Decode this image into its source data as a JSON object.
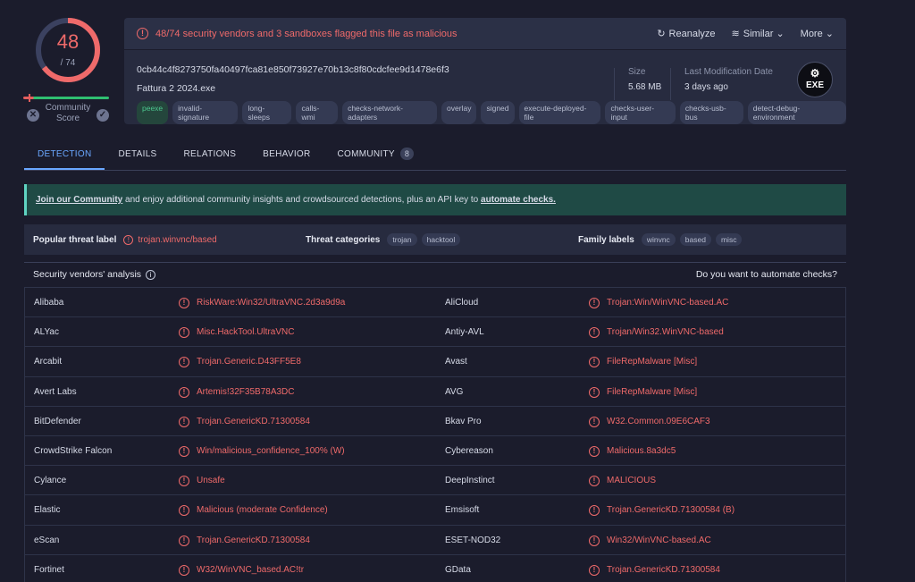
{
  "score": {
    "detected": "48",
    "total": "/ 74",
    "community_label": "Community Score"
  },
  "header": {
    "alert": "48/74 security vendors and 3 sandboxes flagged this file as malicious",
    "actions": {
      "reanalyze": "Reanalyze",
      "similar": "Similar",
      "more": "More"
    },
    "hash": "0cb44c4f8273750fa40497fca81e850f73927e70b13c8f80cdcfee9d1478e6f3",
    "filename": "Fattura 2 2024.exe",
    "tags": [
      "peexe",
      "invalid-signature",
      "long-sleeps",
      "calls-wmi",
      "checks-network-adapters",
      "overlay",
      "signed",
      "execute-deployed-file",
      "checks-user-input",
      "checks-usb-bus",
      "detect-debug-environment"
    ],
    "size_label": "Size",
    "size_value": "5.68 MB",
    "lastmod_label": "Last Modification Date",
    "lastmod_value": "3 days ago",
    "file_type": "EXE"
  },
  "tabs": [
    {
      "label": "DETECTION"
    },
    {
      "label": "DETAILS"
    },
    {
      "label": "RELATIONS"
    },
    {
      "label": "BEHAVIOR"
    },
    {
      "label": "COMMUNITY",
      "count": "8"
    }
  ],
  "banner": {
    "join": "Join our Community",
    "middle": " and enjoy additional community insights and crowdsourced detections, plus an API key to ",
    "automate": "automate checks."
  },
  "threat": {
    "popular_label": "Popular threat label",
    "popular_value": "trojan.winvnc/based",
    "categories_label": "Threat categories",
    "categories": [
      "trojan",
      "hacktool"
    ],
    "family_label": "Family labels",
    "families": [
      "winvnc",
      "based",
      "misc"
    ]
  },
  "vendors_header": {
    "title": "Security vendors' analysis",
    "automate": "Do you want to automate checks?"
  },
  "vendors": [
    [
      {
        "name": "Alibaba",
        "result": "RiskWare:Win32/UltraVNC.2d3a9d9a"
      },
      {
        "name": "AliCloud",
        "result": "Trojan:Win/WinVNC-based.AC"
      }
    ],
    [
      {
        "name": "ALYac",
        "result": "Misc.HackTool.UltraVNC"
      },
      {
        "name": "Antiy-AVL",
        "result": "Trojan/Win32.WinVNC-based"
      }
    ],
    [
      {
        "name": "Arcabit",
        "result": "Trojan.Generic.D43FF5E8"
      },
      {
        "name": "Avast",
        "result": "FileRepMalware [Misc]"
      }
    ],
    [
      {
        "name": "Avert Labs",
        "result": "Artemis!32F35B78A3DC"
      },
      {
        "name": "AVG",
        "result": "FileRepMalware [Misc]"
      }
    ],
    [
      {
        "name": "BitDefender",
        "result": "Trojan.GenericKD.71300584"
      },
      {
        "name": "Bkav Pro",
        "result": "W32.Common.09E6CAF3"
      }
    ],
    [
      {
        "name": "CrowdStrike Falcon",
        "result": "Win/malicious_confidence_100% (W)"
      },
      {
        "name": "Cybereason",
        "result": "Malicious.8a3dc5"
      }
    ],
    [
      {
        "name": "Cylance",
        "result": "Unsafe"
      },
      {
        "name": "DeepInstinct",
        "result": "MALICIOUS"
      }
    ],
    [
      {
        "name": "Elastic",
        "result": "Malicious (moderate Confidence)"
      },
      {
        "name": "Emsisoft",
        "result": "Trojan.GenericKD.71300584 (B)"
      }
    ],
    [
      {
        "name": "eScan",
        "result": "Trojan.GenericKD.71300584"
      },
      {
        "name": "ESET-NOD32",
        "result": "Win32/WinVNC-based.AC"
      }
    ],
    [
      {
        "name": "Fortinet",
        "result": "W32/WinVNC_based.AC!tr"
      },
      {
        "name": "GData",
        "result": "Trojan.GenericKD.71300584"
      }
    ]
  ],
  "colors": {
    "accent": "#6aa7ff",
    "malicious": "#ef6a6a",
    "bg": "#1b1c2c"
  }
}
